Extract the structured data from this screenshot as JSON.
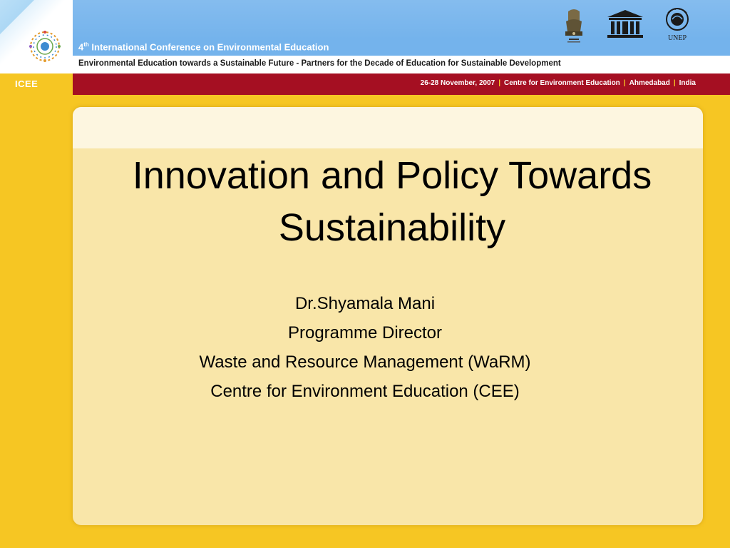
{
  "header": {
    "conference_ordinal": "4",
    "conference_ordinal_suffix": "th",
    "conference_title": "International Conference on Environmental Education",
    "subtitle": "Environmental Education towards a Sustainable Future - Partners for the Decade of Education for Sustainable Development",
    "badge": "ICEE",
    "dates": "26-28 November, 2007",
    "venue": "Centre for Environment Education",
    "city": "Ahmedabad",
    "country": "India",
    "separator": "|",
    "emblems": {
      "unesco_label": "UNESCO",
      "unep_label": "UNEP"
    }
  },
  "slide": {
    "title_line1": "Innovation and Policy Towards",
    "title_line2": "Sustainability",
    "presenter_name": "Dr.Shyamala Mani",
    "presenter_role": "Programme Director",
    "presenter_dept": "Waste and Resource Management (WaRM)",
    "presenter_org": "Centre for Environment Education (CEE)"
  },
  "colors": {
    "background": "#f6c623",
    "header_blue": "#74b3ec",
    "band_red": "#a50f22",
    "panel": "#f9e6a9"
  }
}
